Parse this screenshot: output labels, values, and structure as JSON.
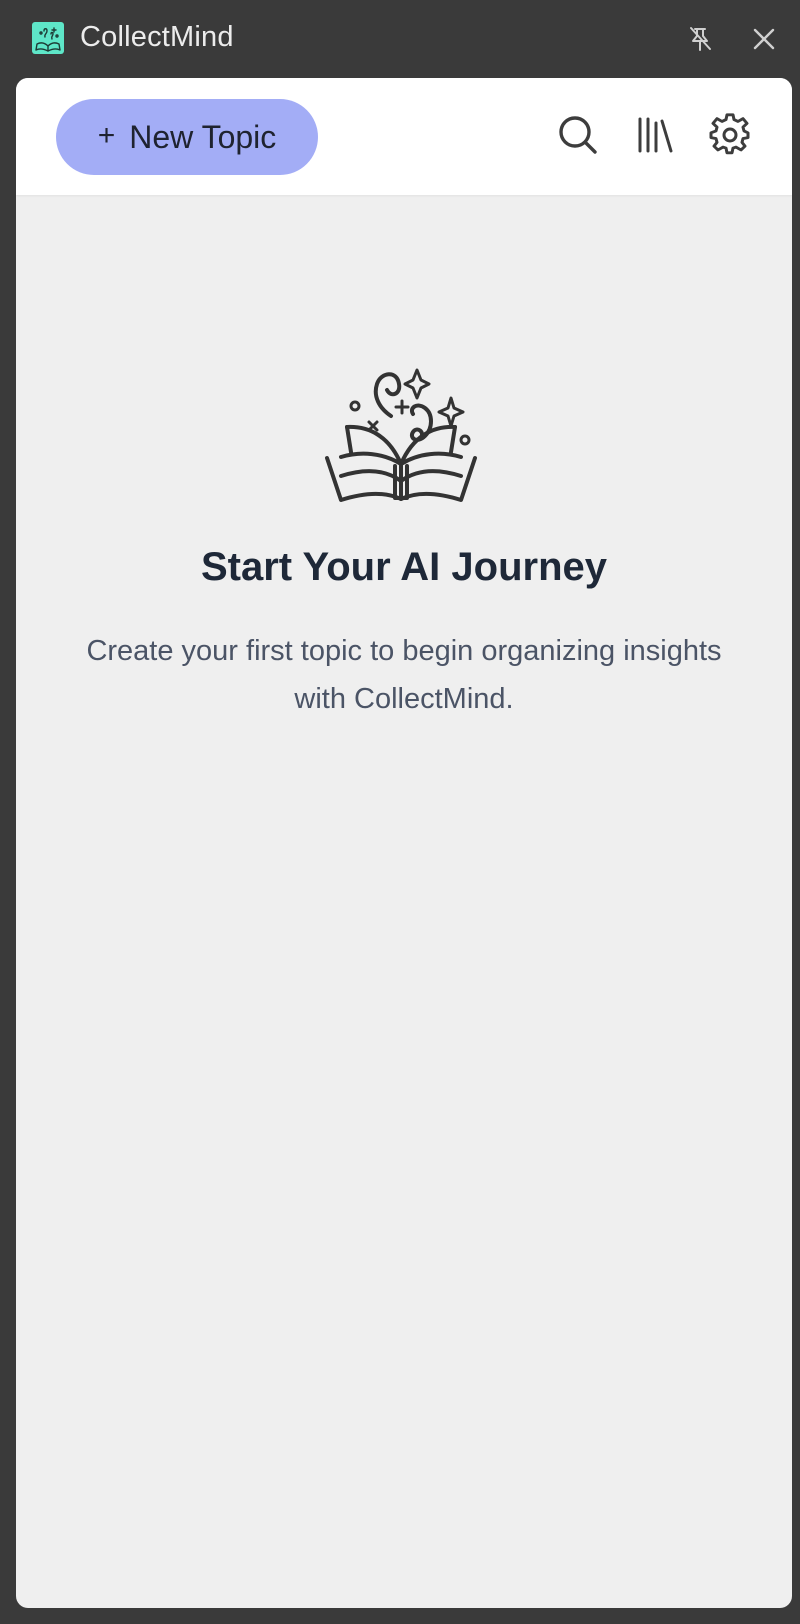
{
  "window": {
    "title": "CollectMind",
    "app_icon": "collectmind-logo",
    "pin_icon": "pin-off-icon",
    "close_icon": "close-icon"
  },
  "toolbar": {
    "new_topic_label": "New Topic",
    "new_topic_icon": "plus-icon",
    "icons": [
      "search-icon",
      "library-icon",
      "gear-icon"
    ]
  },
  "empty_state": {
    "illustration": "magic-book-icon",
    "title": "Start Your AI Journey",
    "description": "Create your first topic to begin organizing insights with CollectMind."
  },
  "colors": {
    "titlebar_bg": "#3a3a3a",
    "panel_bg": "#efefef",
    "toolbar_bg": "#ffffff",
    "accent_button": "#a3adf6",
    "logo_bg": "#5ee6c8",
    "title_text": "#1e2838",
    "body_text": "#4b5466"
  }
}
